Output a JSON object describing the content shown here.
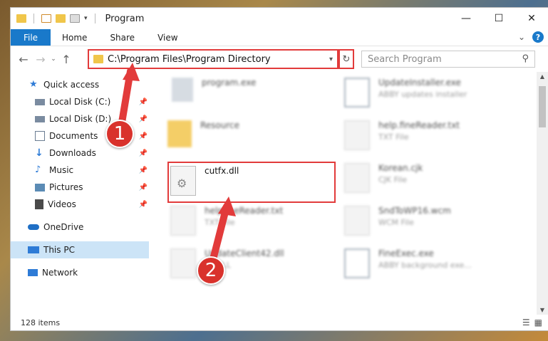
{
  "window": {
    "title": "Program"
  },
  "ribbon": {
    "file": "File",
    "tabs": [
      "Home",
      "Share",
      "View"
    ],
    "help": "?"
  },
  "address": {
    "path": "C:\\Program Files\\Program Directory"
  },
  "search": {
    "placeholder": "Search Program"
  },
  "sidebar": {
    "items": [
      {
        "label": "Quick access",
        "icon": "star-icon",
        "color": "#2e7bd6"
      },
      {
        "label": "Local Disk (C:)",
        "icon": "drive-icon",
        "color": "#7a8ba0"
      },
      {
        "label": "Local Disk (D:)",
        "icon": "drive-icon",
        "color": "#7a8ba0"
      },
      {
        "label": "Documents",
        "icon": "documents-icon",
        "color": "#6b7d92"
      },
      {
        "label": "Downloads",
        "icon": "download-icon",
        "color": "#2e7bd6"
      },
      {
        "label": "Music",
        "icon": "music-icon",
        "color": "#2e7bd6"
      },
      {
        "label": "Pictures",
        "icon": "pictures-icon",
        "color": "#5b8bb5"
      },
      {
        "label": "Videos",
        "icon": "videos-icon",
        "color": "#4a4a4a"
      },
      {
        "label": "OneDrive",
        "icon": "cloud-icon",
        "color": "#1f6fc5"
      },
      {
        "label": "This PC",
        "icon": "computer-icon",
        "color": "#2e7bd6"
      },
      {
        "label": "Network",
        "icon": "network-icon",
        "color": "#2e7bd6"
      }
    ]
  },
  "files": [
    {
      "name": "program.exe",
      "sub": ""
    },
    {
      "name": "UpdateInstaller.exe",
      "sub": "ABBY updates installer"
    },
    {
      "name": "Resource",
      "sub": ""
    },
    {
      "name": "help.fineReader.txt",
      "sub": "TXT File"
    },
    {
      "name": "cutfx.dll",
      "sub": ""
    },
    {
      "name": "Korean.cjk",
      "sub": "CJK File"
    },
    {
      "name": "helpfineReader.txt",
      "sub": "TXT File"
    },
    {
      "name": "SndToWP16.wcm",
      "sub": "WCM File"
    },
    {
      "name": "UpdateClient42.dll",
      "sub": "ce DLL"
    },
    {
      "name": "FineExec.exe",
      "sub": "ABBY background exe..."
    }
  ],
  "status": {
    "items": "128 items"
  },
  "callouts": [
    "1",
    "2"
  ],
  "colors": {
    "accent": "#1979ca",
    "highlight": "#e23b3b",
    "callout": "#d9322c",
    "selected": "#cce4f7"
  }
}
